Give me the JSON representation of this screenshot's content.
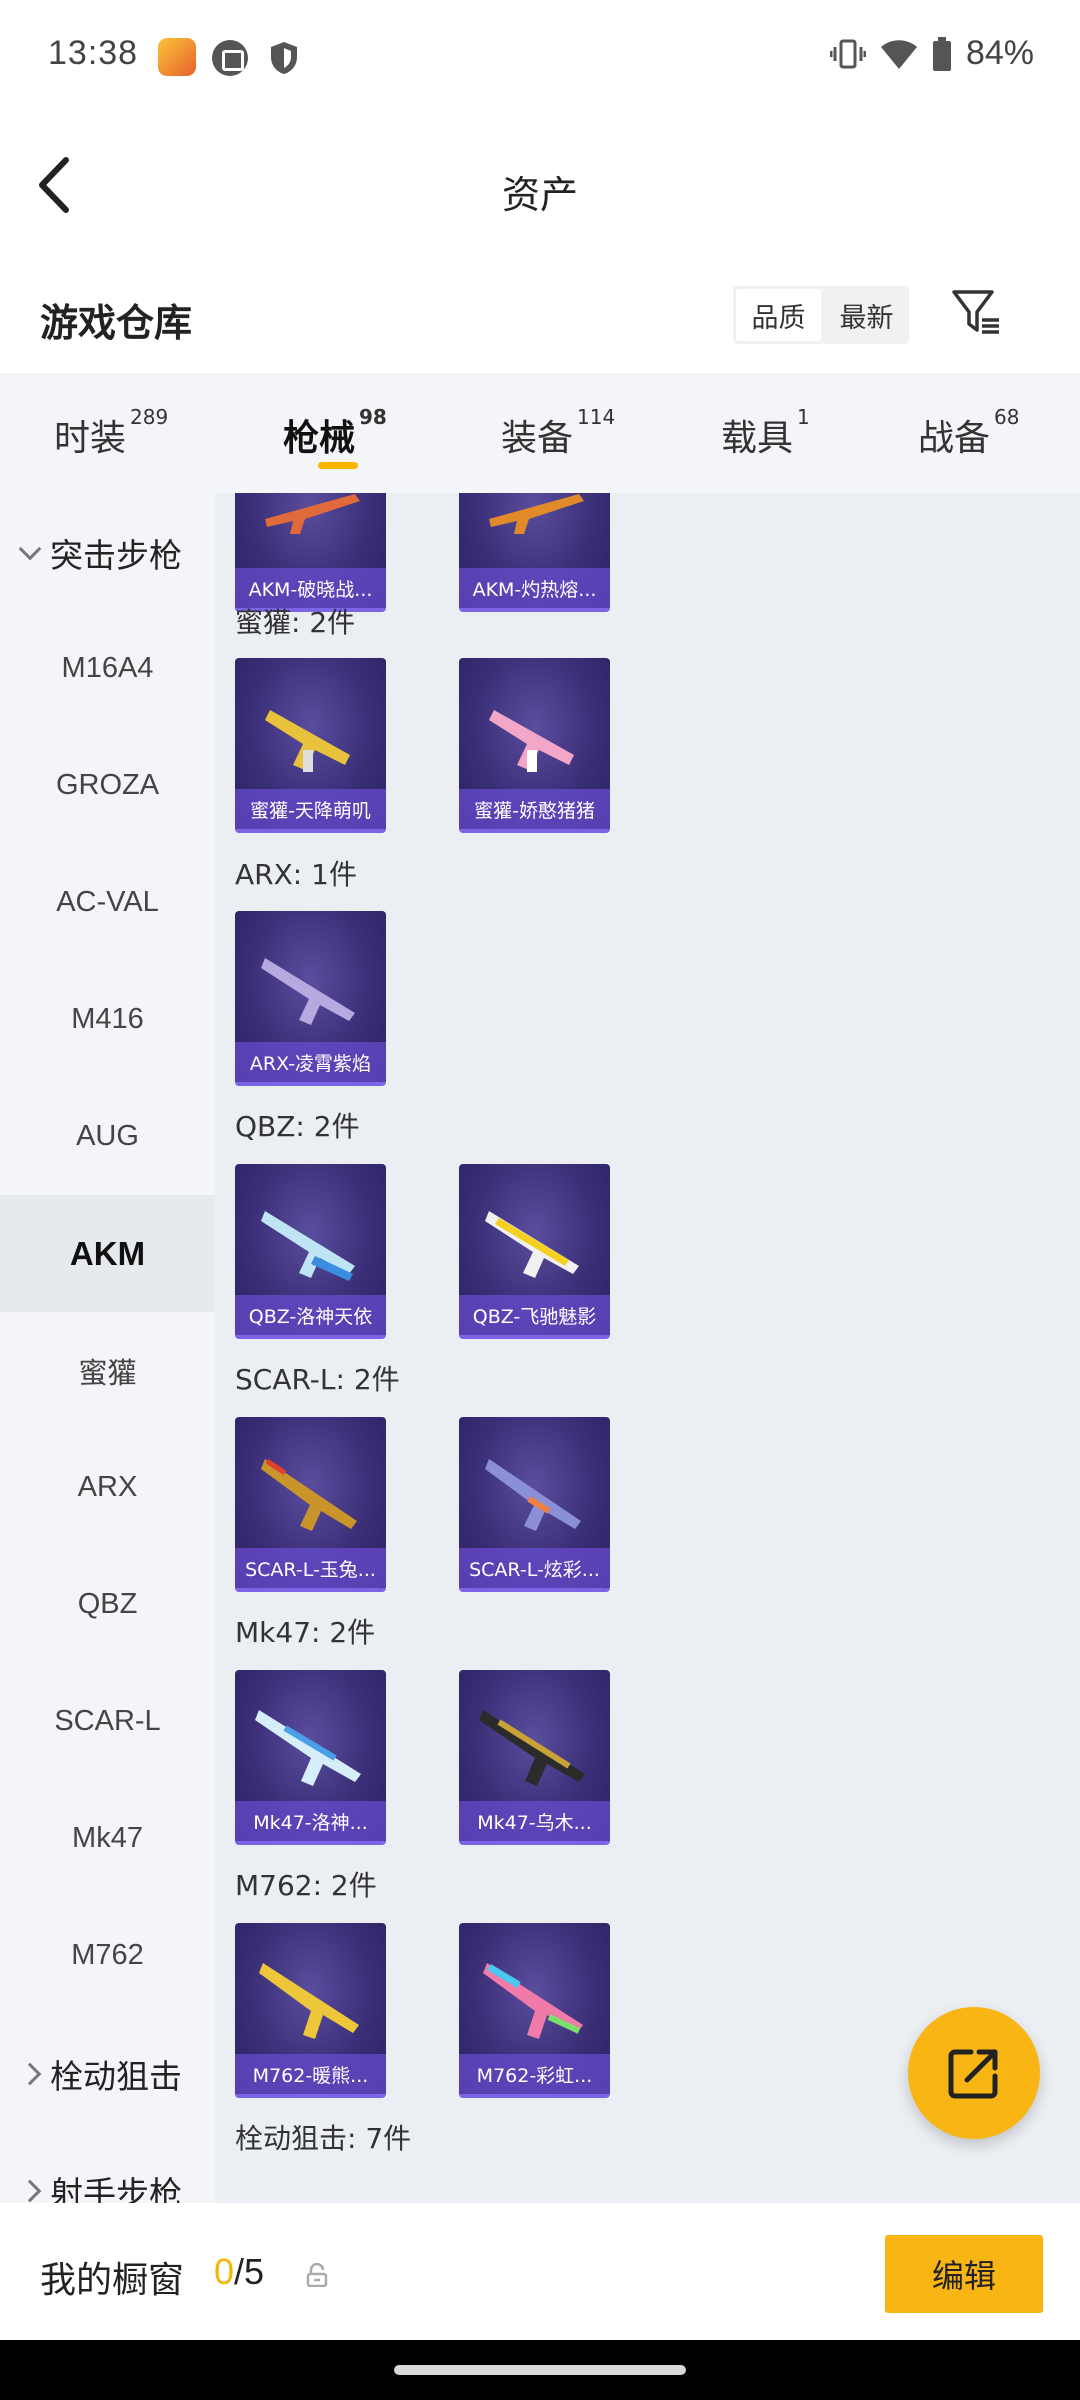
{
  "status_bar": {
    "time": "13:38",
    "battery": "84%"
  },
  "header": {
    "title": "资产"
  },
  "warehouse": {
    "title": "游戏仓库",
    "sort_options": [
      "品质",
      "最新"
    ],
    "sort_selected": "品质"
  },
  "tabs": [
    {
      "label": "时装",
      "count": "289"
    },
    {
      "label": "枪械",
      "count": "98",
      "active": true
    },
    {
      "label": "装备",
      "count": "114"
    },
    {
      "label": "载具",
      "count": "1"
    },
    {
      "label": "战备",
      "count": "68"
    }
  ],
  "sidebar": {
    "groups": [
      {
        "label": "突击步枪",
        "expanded": true
      },
      {
        "label": "栓动狙击",
        "expanded": false
      },
      {
        "label": "射手步枪",
        "expanded": false
      }
    ],
    "items": [
      "M16A4",
      "GROZA",
      "AC-VAL",
      "M416",
      "AUG",
      "AKM",
      "蜜獾",
      "ARX",
      "QBZ",
      "SCAR-L",
      "Mk47",
      "M762"
    ],
    "active_item": "AKM"
  },
  "content": {
    "top_cards": [
      "AKM-破晓战...",
      "AKM-灼热熔..."
    ],
    "sections": [
      {
        "label": "蜜獾: 2件",
        "cards": [
          "蜜獾-天降萌叽",
          "蜜獾-娇憨猪猪"
        ]
      },
      {
        "label": "ARX: 1件",
        "cards": [
          "ARX-凌霄紫焰"
        ]
      },
      {
        "label": "QBZ: 2件",
        "cards": [
          "QBZ-洛神天依",
          "QBZ-飞驰魅影"
        ]
      },
      {
        "label": "SCAR-L: 2件",
        "cards": [
          "SCAR-L-玉兔...",
          "SCAR-L-炫彩..."
        ]
      },
      {
        "label": "Mk47: 2件",
        "cards": [
          "Mk47-洛神...",
          "Mk47-乌木..."
        ]
      },
      {
        "label": "M762: 2件",
        "cards": [
          "M762-暖熊...",
          "M762-彩虹..."
        ]
      },
      {
        "label": "栓动狙击: 7件",
        "cards": []
      }
    ]
  },
  "bottom_bar": {
    "showcase_label": "我的橱窗",
    "showcase_current": "0",
    "showcase_total": "/5",
    "edit_label": "编辑"
  },
  "colors": {
    "accent": "#f9b513",
    "card_bg": "#3b2f78",
    "card_label": "#7b64e6"
  },
  "icons": [
    "back-arrow-icon",
    "filter-icon",
    "share-out-icon",
    "lock-icon",
    "shield-icon",
    "calendar-icon",
    "vibrate-icon",
    "wifi-icon",
    "battery-icon"
  ]
}
